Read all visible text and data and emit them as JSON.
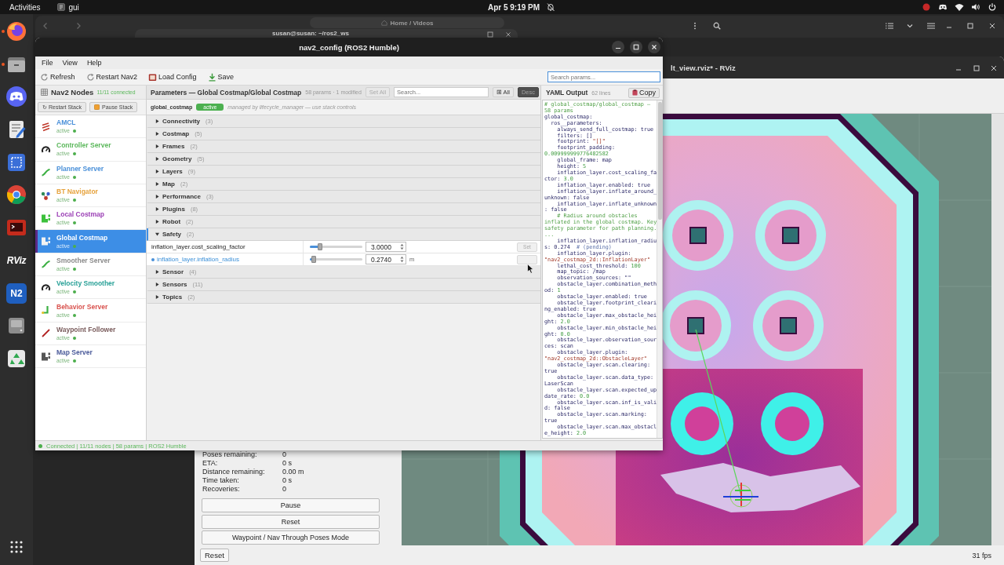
{
  "top_bar": {
    "activities": "Activities",
    "app_name": "gui",
    "clock": "Apr 5 9:19 PM"
  },
  "dock": {
    "items": [
      {
        "kind": "browser",
        "running": true
      },
      {
        "kind": "files",
        "running": true
      },
      {
        "kind": "chat",
        "running": false
      },
      {
        "kind": "editor",
        "running": false
      },
      {
        "kind": "capture",
        "running": false
      },
      {
        "kind": "web",
        "running": false
      },
      {
        "kind": "terminal",
        "running": false
      },
      {
        "kind": "logo",
        "label": "RViz",
        "running": false
      },
      {
        "kind": "tile",
        "label": "N2",
        "running": false
      },
      {
        "kind": "disk",
        "running": false
      },
      {
        "kind": "trash",
        "running": false
      }
    ]
  },
  "files_window": {
    "breadcrumb": "Home / Videos"
  },
  "terminal_window": {
    "title": "susan@susan: ~/ros2_ws"
  },
  "rviz_window": {
    "title": "lt_view.rviz* - RViz",
    "stats": [
      {
        "label": "Poses remaining:",
        "value": "0"
      },
      {
        "label": "ETA:",
        "value": "0 s"
      },
      {
        "label": "Distance remaining:",
        "value": "0.00 m"
      },
      {
        "label": "Time taken:",
        "value": "0 s"
      },
      {
        "label": "Recoveries:",
        "value": "0"
      }
    ],
    "buttons": [
      "Pause",
      "Reset",
      "Waypoint / Nav Through Poses Mode"
    ],
    "bottom_button": "Reset",
    "fps": "31 fps"
  },
  "nav2_window": {
    "title": "nav2_config (ROS2 Humble)",
    "menu": [
      "File",
      "View",
      "Help"
    ],
    "toolbar": [
      {
        "kind": "refresh",
        "label": "Refresh"
      },
      {
        "kind": "restart",
        "label": "Restart Nav2"
      },
      {
        "kind": "load",
        "label": "Load Config"
      },
      {
        "kind": "save",
        "label": "Save"
      }
    ],
    "search": {
      "placeholder": "Search params..."
    },
    "nodes_panel": {
      "title": "Nav2 Nodes",
      "connected": "11/11 connected",
      "buttons": [
        {
          "kind": "restart",
          "label": "↻ Restart Stack"
        },
        {
          "kind": "pause",
          "label": "Pause Stack"
        }
      ],
      "nodes": [
        {
          "name": "AMCL",
          "status": "active",
          "kind": "localizer",
          "color": "#4a90d9",
          "selected": false
        },
        {
          "name": "Controller Server",
          "status": "active",
          "kind": "controller",
          "color": "#5cb85c",
          "selected": false
        },
        {
          "name": "Planner Server",
          "status": "active",
          "kind": "planner",
          "color": "#4a90d9",
          "selected": false
        },
        {
          "name": "BT Navigator",
          "status": "active",
          "kind": "navigator",
          "color": "#e6a23c",
          "selected": false
        },
        {
          "name": "Local Costmap",
          "status": "active",
          "kind": "costmap",
          "color": "#9b3fb5",
          "selected": false
        },
        {
          "name": "Global Costmap",
          "status": "active",
          "kind": "costmap",
          "color": "#5b2a86",
          "selected": true
        },
        {
          "name": "Smoother Server",
          "status": "active",
          "kind": "smoother",
          "color": "#8c8c8c",
          "selected": false
        },
        {
          "name": "Velocity Smoother",
          "status": "active",
          "kind": "velocity",
          "color": "#2aa198",
          "selected": false
        },
        {
          "name": "Behavior Server",
          "status": "active",
          "kind": "behavior",
          "color": "#d9534f",
          "selected": false
        },
        {
          "name": "Waypoint Follower",
          "status": "active",
          "kind": "follower",
          "color": "#7a5c5c",
          "selected": false
        },
        {
          "name": "Map Server",
          "status": "active",
          "kind": "mapserver",
          "color": "#4a5a9a",
          "selected": false
        }
      ]
    },
    "params_panel": {
      "title": "Parameters — Global Costmap/Global Costmap",
      "summary": "58 params · 1 modified",
      "set_all": "Set All",
      "search": {
        "placeholder": "Search..."
      },
      "expand_all": "⊞ All",
      "desc": {
        "label": "Desc",
        "on": true
      },
      "node_row": {
        "name": "global_costmap",
        "badge": "active",
        "note": "managed by lifecycle_manager — use stack controls"
      },
      "groups": [
        {
          "name": "Connectivity",
          "count": "(3)",
          "expanded": false
        },
        {
          "name": "Costmap",
          "count": "(5)",
          "expanded": false
        },
        {
          "name": "Frames",
          "count": "(2)",
          "expanded": false
        },
        {
          "name": "Geometry",
          "count": "(5)",
          "expanded": false
        },
        {
          "name": "Layers",
          "count": "(9)",
          "expanded": false
        },
        {
          "name": "Map",
          "count": "(2)",
          "expanded": false
        },
        {
          "name": "Performance",
          "count": "(3)",
          "expanded": false
        },
        {
          "name": "Plugins",
          "count": "(8)",
          "expanded": false
        },
        {
          "name": "Robot",
          "count": "(2)",
          "expanded": false
        },
        {
          "name": "Safety",
          "count": "(2)",
          "expanded": true,
          "params": [
            {
              "name": "inflation_layer.cost_scaling_factor",
              "modified": false,
              "level": 0.19,
              "value": "3.0000",
              "button": "Set"
            },
            {
              "name": "inflation_layer.inflation_radius",
              "modified": true,
              "level": 0.08,
              "value": "0.2740",
              "unit": "m"
            }
          ]
        },
        {
          "name": "Sensor",
          "count": "(4)",
          "expanded": false
        },
        {
          "name": "Sensors",
          "count": "(11)",
          "expanded": false
        },
        {
          "name": "Topics",
          "count": "(2)",
          "expanded": false
        }
      ]
    },
    "yaml": {
      "title": "YAML Output",
      "line_count": "62 lines",
      "copy": "Copy",
      "tree": [
        {
          "kind": "comment",
          "text": "# global_costmap/global_costmap — 58 params"
        },
        {
          "key": "global_costmap:",
          "children": [
            {
              "key": "ros__parameters:",
              "children": [
                {
                  "kind": "plain",
                  "key": "always_send_full_costmap:",
                  "value": "true"
                },
                {
                  "kind": "plain",
                  "key": "filters:",
                  "value": "[]"
                },
                {
                  "kind": "string",
                  "key": "footprint:",
                  "value": "\"[]\""
                },
                {
                  "kind": "number",
                  "key": "footprint_padding:",
                  "value": "0.009999999776482582"
                },
                {
                  "kind": "plain",
                  "key": "global_frame:",
                  "value": "map"
                },
                {
                  "kind": "number",
                  "key": "height:",
                  "value": "5"
                },
                {
                  "kind": "number",
                  "key": "inflation_layer.cost_scaling_factor:",
                  "value": "3.0"
                },
                {
                  "kind": "plain",
                  "key": "inflation_layer.enabled:",
                  "value": "true"
                },
                {
                  "kind": "plain",
                  "key": "inflation_layer.inflate_around_unknown:",
                  "value": "false"
                },
                {
                  "kind": "plain",
                  "key": "inflation_layer.inflate_unknown:",
                  "value": "false"
                },
                {
                  "kind": "comment",
                  "text": "# Radius around obstacles inflated in the global costmap. Key safety parameter for path planning. ..."
                },
                {
                  "kind": "plain",
                  "key": "inflation_layer.inflation_radius:",
                  "value": "0.274",
                  "note": "# (pending)"
                },
                {
                  "kind": "string",
                  "key": "inflation_layer.plugin:",
                  "value": "\"nav2_costmap_2d::InflationLayer\""
                },
                {
                  "kind": "number",
                  "key": "lethal_cost_threshold:",
                  "value": "100"
                },
                {
                  "kind": "plain",
                  "key": "map_topic:",
                  "value": "/map"
                },
                {
                  "kind": "plain",
                  "key": "observation_sources:",
                  "value": "\"\""
                },
                {
                  "kind": "number",
                  "key": "obstacle_layer.combination_method:",
                  "value": "1"
                },
                {
                  "kind": "plain",
                  "key": "obstacle_layer.enabled:",
                  "value": "true"
                },
                {
                  "kind": "plain",
                  "key": "obstacle_layer.footprint_clearing_enabled:",
                  "value": "true"
                },
                {
                  "kind": "number",
                  "key": "obstacle_layer.max_obstacle_height:",
                  "value": "2.0"
                },
                {
                  "kind": "number",
                  "key": "obstacle_layer.min_obstacle_height:",
                  "value": "0.0"
                },
                {
                  "kind": "plain",
                  "key": "obstacle_layer.observation_sources:",
                  "value": "scan"
                },
                {
                  "kind": "string",
                  "key": "obstacle_layer.plugin:",
                  "value": "\"nav2_costmap_2d::ObstacleLayer\""
                },
                {
                  "kind": "plain",
                  "key": "obstacle_layer.scan.clearing:",
                  "value": "true"
                },
                {
                  "kind": "plain",
                  "key": "obstacle_layer.scan.data_type:",
                  "value": "LaserScan"
                },
                {
                  "kind": "number",
                  "key": "obstacle_layer.scan.expected_update_rate:",
                  "value": "0.0"
                },
                {
                  "kind": "plain",
                  "key": "obstacle_layer.scan.inf_is_valid:",
                  "value": "false"
                },
                {
                  "kind": "plain",
                  "key": "obstacle_layer.scan.marking:",
                  "value": "true"
                },
                {
                  "kind": "number",
                  "key": "obstacle_layer.scan.max_obstacle_height:",
                  "value": "2.0"
                }
              ]
            }
          ]
        }
      ]
    },
    "status_bar": {
      "connected": true,
      "text": "Connected | 11/11 nodes | 58 params | ROS2 Humble"
    }
  }
}
